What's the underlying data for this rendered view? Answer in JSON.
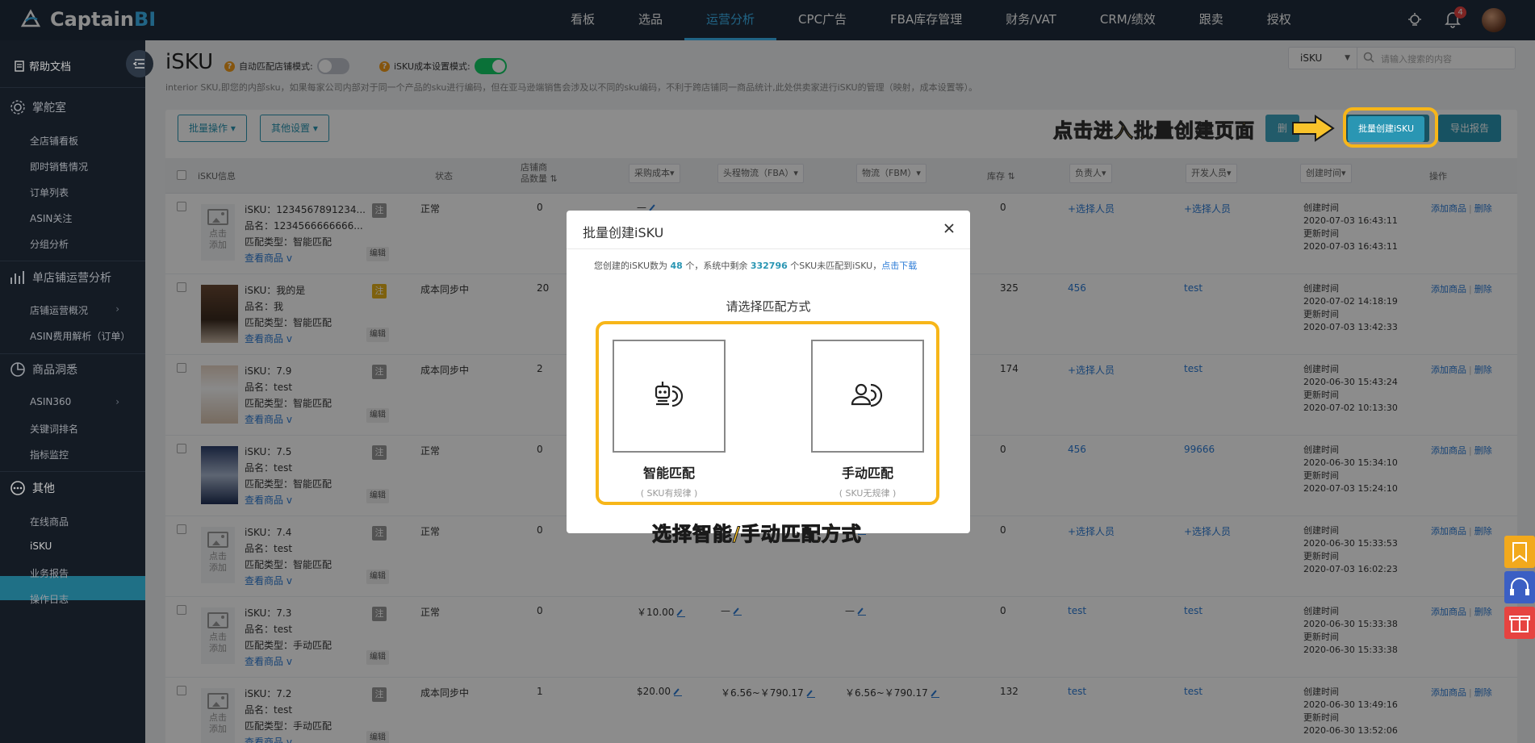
{
  "brand": {
    "name_a": "Captain",
    "name_b": "BI"
  },
  "topnav": [
    "看板",
    "选品",
    "运营分析",
    "CPC广告",
    "FBA库存管理",
    "财务/VAT",
    "CRM/绩效",
    "跟卖",
    "授权"
  ],
  "notif_count": "4",
  "sidebar": {
    "help": "帮助文档",
    "groups": [
      {
        "title": "掌舵室",
        "items": [
          "全店铺看板",
          "即时销售情况",
          "订单列表",
          "ASIN关注",
          "分组分析"
        ]
      },
      {
        "title": "单店铺运营分析",
        "items": [
          "店铺运营概况",
          "ASIN费用解析（订单）"
        ]
      },
      {
        "title": "商品洞悉",
        "items": [
          "ASIN360",
          "关键词排名",
          "指标监控"
        ]
      },
      {
        "title": "其他",
        "items": [
          "在线商品",
          "iSKU",
          "业务报告",
          "操作日志"
        ]
      }
    ]
  },
  "page": {
    "title": "iSKU",
    "auto_match_label": "自动匹配店铺模式:",
    "cost_mode_label": "iSKU成本设置模式:",
    "description": "interior SKU,即您的内部sku，如果每家公司内部对于同一个产品的sku进行编码，但在亚马逊端销售会涉及以不同的sku编码，不利于跨店铺同一商品统计,此处供卖家进行iSKU的管理（映射，成本设置等）。",
    "search_select": "iSKU",
    "search_placeholder": "请输入搜索的内容",
    "btn_batch": "批量操作",
    "btn_other": "其他设置",
    "btn_create": "批量创建iSKU",
    "btn_export": "导出报告",
    "btn_partial": "删"
  },
  "table": {
    "headers": {
      "info": "iSKU信息",
      "status": "状态",
      "shop_a": "店铺商",
      "shop_b": "品数量",
      "cost": "采购成本",
      "fba": "头程物流（FBA）",
      "fbm": "物流（FBM）",
      "stock": "库存",
      "owner": "负责人",
      "dev": "开发人员",
      "created": "创建时间",
      "ops": "操作"
    },
    "rows": [
      {
        "isku": "iSKU：1234567891234...",
        "name": "品名：1234566666666...",
        "match": "匹配类型：智能匹配",
        "view": "查看商品",
        "tag": "注",
        "edit": "编辑",
        "status": "正常",
        "count": "0",
        "cost": "—",
        "fba": "",
        "fbm": "",
        "stock": "0",
        "owner": "+选择人员",
        "dev": "+选择人员",
        "c_label": "创建时间",
        "c_time": "2020-07-03 16:43:11",
        "u_label": "更新时间",
        "u_time": "2020-07-03 16:43:11",
        "add": "添加商品",
        "del": "删除",
        "img": "placeholder"
      },
      {
        "isku": "iSKU：我的是",
        "name": "品名：我",
        "match": "匹配类型：智能匹配",
        "view": "查看商品",
        "tag": "注",
        "edit": "编辑",
        "status": "成本同步中",
        "count": "20",
        "cost": "",
        "fba": "",
        "fbm": "",
        "stock": "325",
        "owner": "456",
        "dev": "test",
        "c_label": "创建时间",
        "c_time": "2020-07-02 14:18:19",
        "u_label": "更新时间",
        "u_time": "2020-07-03 13:42:33",
        "add": "添加商品",
        "del": "删除",
        "img": "coat"
      },
      {
        "isku": "iSKU：7.9",
        "name": "品名：test",
        "match": "匹配类型：智能匹配",
        "view": "查看商品",
        "tag": "注",
        "edit": "编辑",
        "status": "成本同步中",
        "count": "2",
        "cost": "",
        "fba": "",
        "fbm": "",
        "stock": "174",
        "owner": "+选择人员",
        "dev": "test",
        "c_label": "创建时间",
        "c_time": "2020-06-30 15:43:24",
        "u_label": "更新时间",
        "u_time": "2020-07-02 10:13:30",
        "add": "添加商品",
        "del": "删除",
        "img": "white"
      },
      {
        "isku": "iSKU：7.5",
        "name": "品名：test",
        "match": "匹配类型：智能匹配",
        "view": "查看商品",
        "tag": "注",
        "edit": "编辑",
        "status": "正常",
        "count": "0",
        "cost": "",
        "fba": "",
        "fbm": "",
        "stock": "0",
        "owner": "456",
        "dev": "99666",
        "c_label": "创建时间",
        "c_time": "2020-06-30 15:34:10",
        "u_label": "更新时间",
        "u_time": "2020-07-03 15:24:10",
        "add": "添加商品",
        "del": "删除",
        "img": "screen"
      },
      {
        "isku": "iSKU：7.4",
        "name": "品名：test",
        "match": "匹配类型：智能匹配",
        "view": "查看商品",
        "tag": "注",
        "edit": "编辑",
        "status": "正常",
        "count": "0",
        "cost": "",
        "fba": "",
        "fbm": "—",
        "stock": "0",
        "owner": "+选择人员",
        "dev": "+选择人员",
        "c_label": "创建时间",
        "c_time": "2020-06-30 15:33:53",
        "u_label": "更新时间",
        "u_time": "2020-07-03 16:02:23",
        "add": "添加商品",
        "del": "删除",
        "img": "placeholder"
      },
      {
        "isku": "iSKU：7.3",
        "name": "品名：test",
        "match": "匹配类型：手动匹配",
        "view": "查看商品",
        "tag": "注",
        "edit": "编辑",
        "status": "正常",
        "count": "0",
        "cost": "￥10.00",
        "fba": "—",
        "fbm": "—",
        "stock": "0",
        "owner": "test",
        "dev": "test",
        "c_label": "创建时间",
        "c_time": "2020-06-30 15:33:38",
        "u_label": "更新时间",
        "u_time": "2020-06-30 15:33:38",
        "add": "添加商品",
        "del": "删除",
        "img": "placeholder"
      },
      {
        "isku": "iSKU：7.2",
        "name": "品名：test",
        "match": "匹配类型：手动匹配",
        "view": "查看商品",
        "tag": "注",
        "edit": "编辑",
        "status": "成本同步中",
        "count": "1",
        "cost": "$20.00",
        "fba": "￥6.56~￥790.17",
        "fbm": "￥6.56~￥790.17",
        "stock": "132",
        "owner": "test",
        "dev": "test",
        "c_label": "创建时间",
        "c_time": "2020-06-30 13:49:16",
        "u_label": "更新时间",
        "u_time": "2020-06-30 13:52:06",
        "add": "添加商品",
        "del": "删除",
        "img": "placeholder"
      }
    ],
    "placeholder_a": "点击",
    "placeholder_b": "添加"
  },
  "modal": {
    "title": "批量创建iSKU",
    "info_a": "您创建的iSKU数为",
    "info_count": "48",
    "info_b": "个，系统中剩余",
    "info_remain": "332796",
    "info_c": "个SKU未匹配到iSKU，",
    "info_link": "点击下载",
    "choose": "请选择匹配方式",
    "smart": "智能匹配",
    "smart_sub": "( SKU有规律 )",
    "manual": "手动匹配",
    "manual_sub": "( SKU无规律 )"
  },
  "callouts": {
    "top": "点击进入批量创建页面",
    "bottom": "选择智能/手动匹配方式"
  },
  "colors": {
    "accent": "#2a96b3",
    "highlight": "#f7b619",
    "topbar": "#1f2d3d",
    "sidebar": "#1b2430"
  }
}
